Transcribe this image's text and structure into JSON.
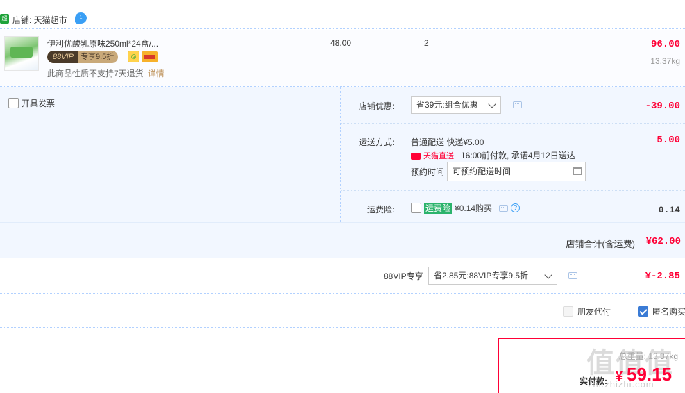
{
  "shop": {
    "icon_text": "超市",
    "label": "店铺: 天猫超市",
    "wangwang_badge": "1"
  },
  "item": {
    "title": "伊利优酸乳原味250ml*24盒/...",
    "vip_badge_left": "88VIP",
    "vip_badge_right": "专享9.5折",
    "return_note": "此商品性质不支持7天退货",
    "details_link": "详情",
    "unit_price": "48.00",
    "quantity": "2",
    "subtotal": "96.00",
    "weight": "13.37kg"
  },
  "invoice": {
    "label": "开具发票"
  },
  "shop_discount": {
    "label": "店铺优惠:",
    "selected": "省39元:组合优惠",
    "amount": "-39.00"
  },
  "shipping": {
    "label": "运送方式:",
    "method": "普通配送 快递¥5.00",
    "tmall_direct": "天猫直送",
    "promise": "16:00前付款, 承诺4月12日送达",
    "schedule_label": "预约时间",
    "schedule_value": "可预约配送时间",
    "amount": "5.00"
  },
  "insurance": {
    "label": "运费险:",
    "tag": "运费险",
    "price": "¥0.14购买",
    "amount": "0.14"
  },
  "shop_total": {
    "label": "店铺合计(含运费)",
    "amount": "¥62.00"
  },
  "vip": {
    "label": "88VIP专享",
    "selected": "省2.85元:88VIP专享9.5折",
    "amount": "¥-2.85"
  },
  "options": {
    "friend_pay": "朋友代付",
    "anonymous": "匿名购买"
  },
  "payment": {
    "weight": "总重量: 13.37kg",
    "paid_label": "实付款:",
    "currency": "¥",
    "amount": "59.15"
  },
  "watermark": {
    "logo": "值值值",
    "url": "zhi.zhizhi.com"
  },
  "colors": {
    "accent_red": "#ff0036",
    "panel_blue": "#f2f7ff",
    "tmall_green": "#2bb36c"
  }
}
